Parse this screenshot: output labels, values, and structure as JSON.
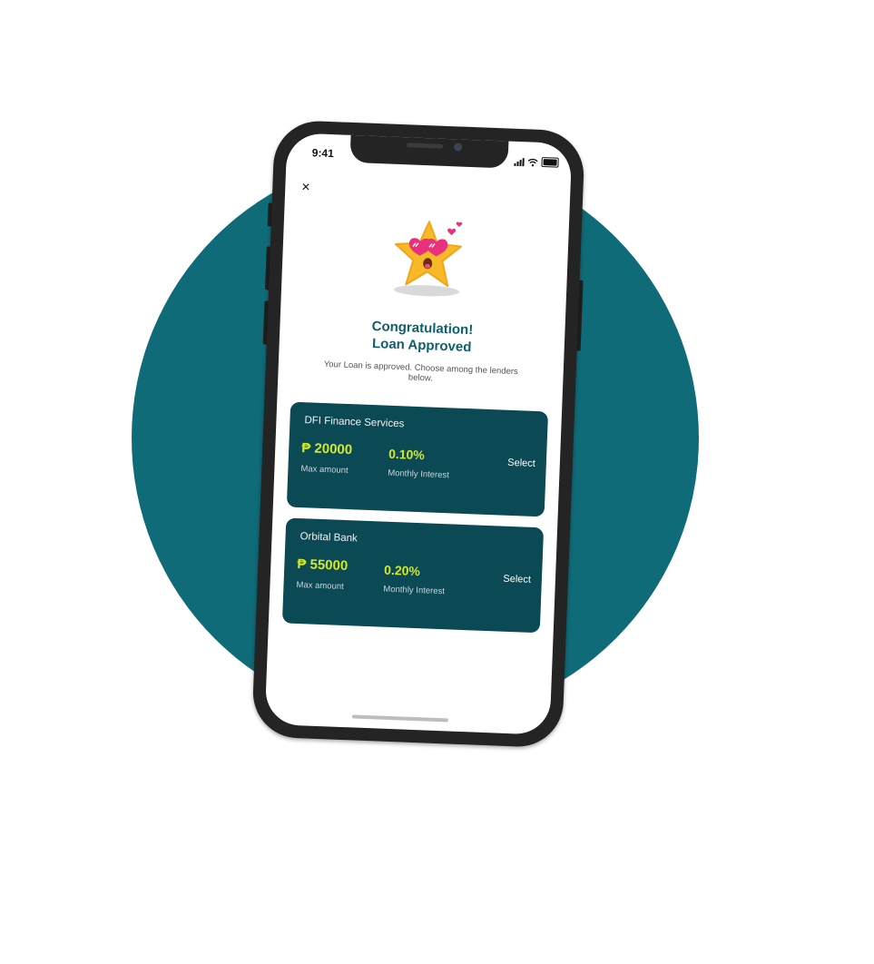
{
  "colors": {
    "background_circle": "#0f6b78",
    "card_bg": "#0b4a55",
    "accent_value": "#d4e82a",
    "title": "#0f5f6c"
  },
  "status_bar": {
    "time": "9:41",
    "icons": [
      "signal-icon",
      "wifi-icon",
      "battery-icon"
    ]
  },
  "close_icon": "×",
  "mascot": "star-mascot-with-heart-sunglasses",
  "header": {
    "title_line1": "Congratulation!",
    "title_line2": "Loan Approved",
    "subtitle": "Your Loan is approved. Choose among the lenders below."
  },
  "lenders": [
    {
      "name": "DFI Finance Services",
      "amount": "₱ 20000",
      "amount_label": "Max amount",
      "interest": "0.10%",
      "interest_label": "Monthly Interest",
      "action": "Select"
    },
    {
      "name": "Orbital Bank",
      "amount": "₱ 55000",
      "amount_label": "Max amount",
      "interest": "0.20%",
      "interest_label": "Monthly Interest",
      "action": "Select"
    }
  ]
}
